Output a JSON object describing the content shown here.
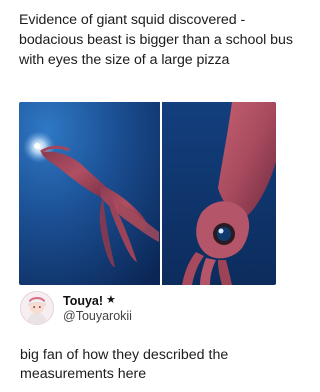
{
  "post": {
    "headline": "Evidence of giant squid discovered - bodacious beast is bigger than a school bus with eyes the size of a large pizza",
    "images": [
      {
        "icon": "squid-photo-full-body"
      },
      {
        "icon": "squid-photo-closeup-eye"
      }
    ]
  },
  "author": {
    "name": "Touya!",
    "badge": "★",
    "handle": "@Touyarokii",
    "avatar_icon": "anime-avatar-icon"
  },
  "caption": "big fan of how they described the measurements here",
  "colors": {
    "ocean_dark": "#0d2f66",
    "ocean_light": "#1f5fa8",
    "squid": "#b8505e",
    "text": "#1c1c1c"
  }
}
